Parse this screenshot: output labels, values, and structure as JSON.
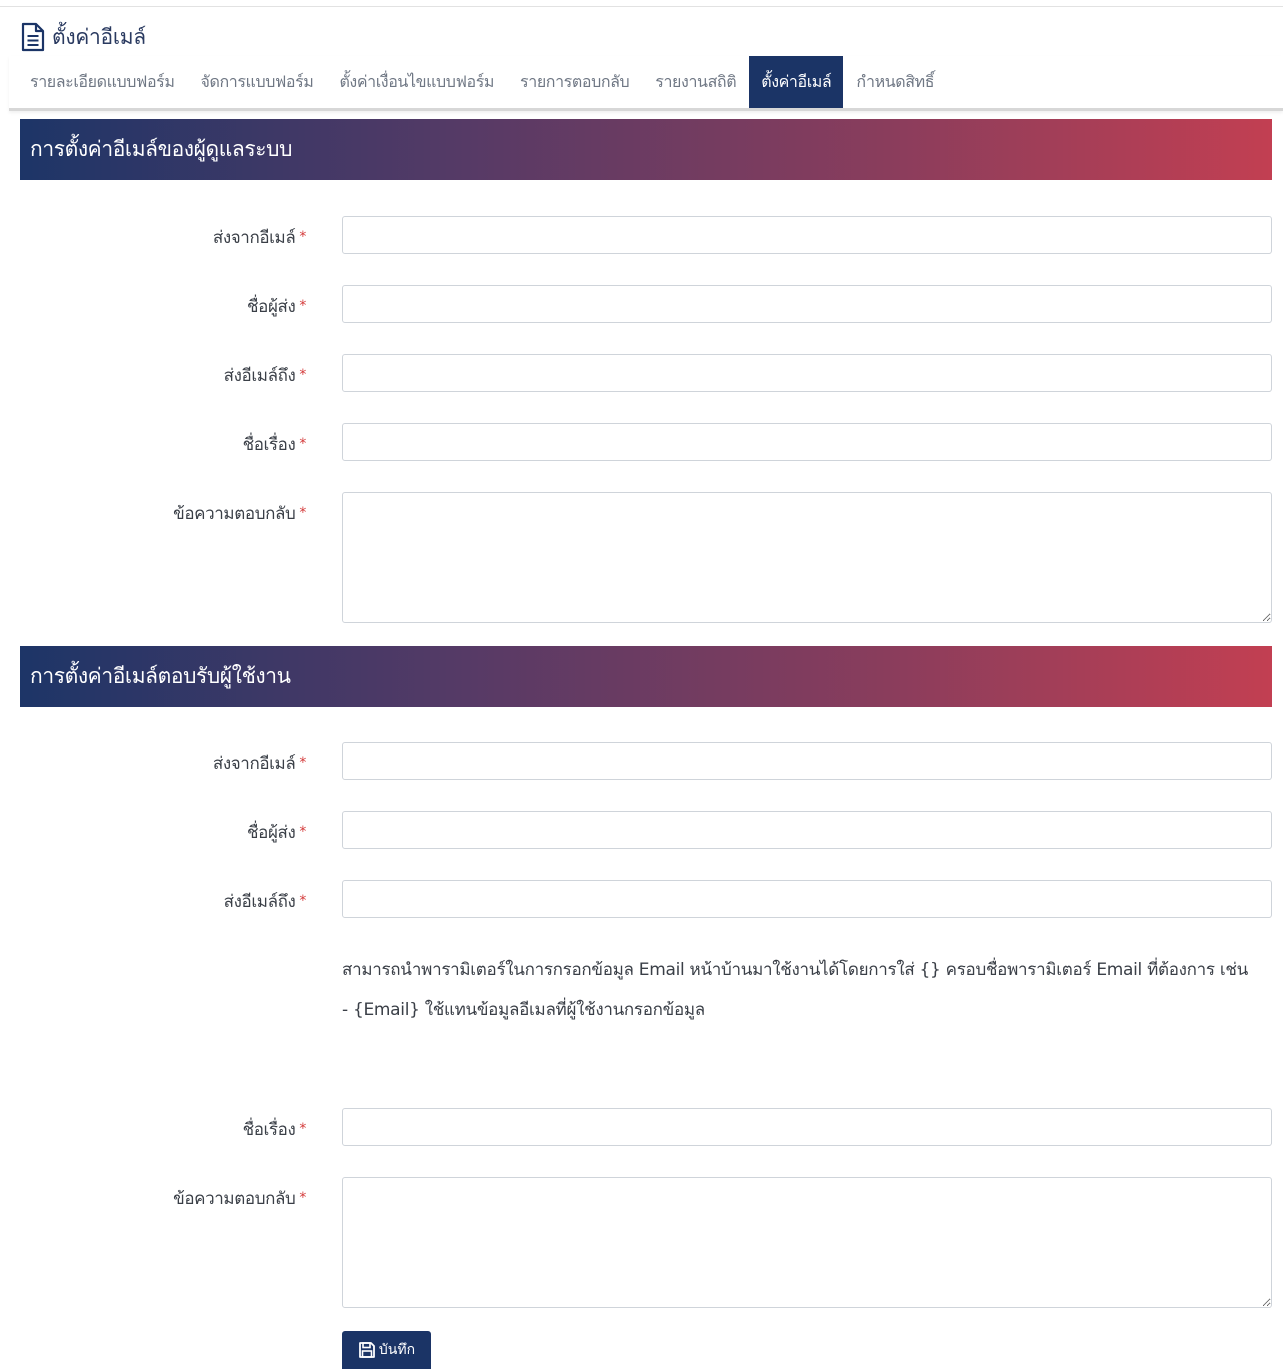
{
  "page": {
    "title": "ตั้งค่าอีเมล์",
    "icon": "document-icon"
  },
  "tabs": [
    {
      "label": "รายละเอียดแบบฟอร์ม",
      "active": false
    },
    {
      "label": "จัดการแบบฟอร์ม",
      "active": false
    },
    {
      "label": "ตั้งค่าเงื่อนไขแบบฟอร์ม",
      "active": false
    },
    {
      "label": "รายการตอบกลับ",
      "active": false
    },
    {
      "label": "รายงานสถิติ",
      "active": false
    },
    {
      "label": "ตั้งค่าอีเมล์",
      "active": true
    },
    {
      "label": "กำหนดสิทธิ์",
      "active": false
    }
  ],
  "admin_section": {
    "title": "การตั้งค่าอีเมล์ของผู้ดูแลระบบ",
    "from_email_label": "ส่งจากอีเมล์",
    "from_email_value": "",
    "sender_name_label": "ชื่อผู้ส่ง",
    "sender_name_value": "",
    "to_email_label": "ส่งอีเมล์ถึง",
    "to_email_value": "",
    "subject_label": "ชื่อเรื่อง",
    "subject_value": "",
    "reply_message_label": "ข้อความตอบกลับ",
    "reply_message_value": ""
  },
  "user_section": {
    "title": "การตั้งค่าอีเมล์ตอบรับผู้ใช้งาน",
    "from_email_label": "ส่งจากอีเมล์",
    "from_email_value": "",
    "sender_name_label": "ชื่อผู้ส่ง",
    "sender_name_value": "",
    "to_email_label": "ส่งอีเมล์ถึง",
    "to_email_value": "",
    "help_line1": "สามารถนำพารามิเตอร์ในการกรอกข้อมูล Email หน้าบ้านมาใช้งานได้โดยการใส่ {} ครอบชื่อพารามิเตอร์ Email ที่ต้องการ เช่น",
    "help_line2": "- {Email} ใช้แทนข้อมูลอีเมลที่ผู้ใช้งานกรอกข้อมูล",
    "subject_label": "ชื่อเรื่อง",
    "subject_value": "",
    "reply_message_label": "ข้อความตอบกลับ",
    "reply_message_value": ""
  },
  "required_marker": "*",
  "save_button": {
    "label": "บันทึก",
    "icon": "floppy-disk-icon"
  },
  "colors": {
    "primary": "#1b3466",
    "gradient_start": "#1d3567",
    "gradient_end": "#c23f52",
    "required": "#d43a3a"
  }
}
